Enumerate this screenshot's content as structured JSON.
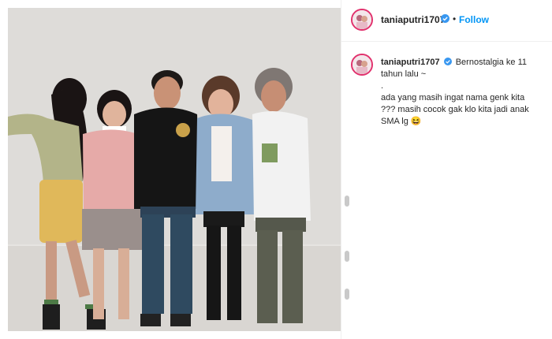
{
  "post": {
    "username": "taniaputri1707",
    "follow_label": "Follow",
    "separator": "•",
    "caption_first": "Bernostalgia ke 11 tahun lalu ~",
    "caption_lines": [
      ".",
      "ada yang masih ingat nama genk kita ??? masih cocok gak klo kita jadi anak SMA lg 😆"
    ]
  },
  "colors": {
    "accent": "#0095f6",
    "verified": "#3897f0",
    "text": "#262626",
    "divider": "#efefef"
  },
  "icons": {
    "verified": "verified-badge-icon"
  }
}
